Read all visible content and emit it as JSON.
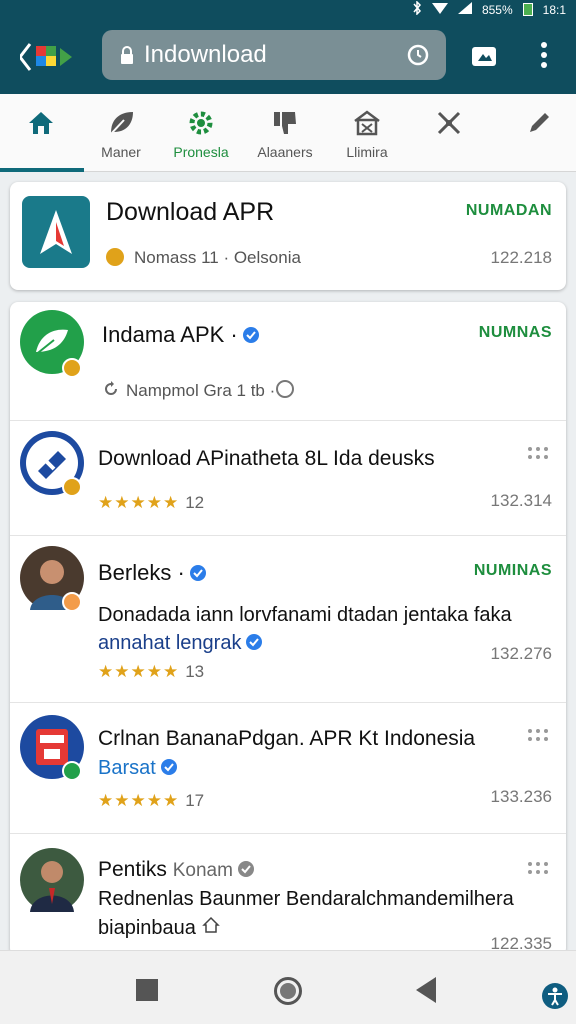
{
  "status_bar": {
    "battery_text": "855%",
    "time": "18:1"
  },
  "browser": {
    "url": "Indownload"
  },
  "categories": [
    {
      "label": "Maner",
      "icon": "home-icon",
      "active": true
    },
    {
      "label": "Manar",
      "icon": "leaf-icon"
    },
    {
      "label": "Pronesla",
      "icon": "gear-icon"
    },
    {
      "label": "Alaaners",
      "icon": "thumbs-down-icon"
    },
    {
      "label": "Llimira",
      "icon": "building-icon"
    },
    {
      "label": "",
      "icon": "tools-icon"
    },
    {
      "label": "",
      "icon": "pencil-icon"
    }
  ],
  "featured": {
    "title": "Download APR",
    "status": "NUMADAN",
    "meta": "Nomass 11 · Oelsonia",
    "number": "122.218"
  },
  "items": [
    {
      "title": "Indama APK ·",
      "status": "NUMNAS",
      "meta": "Nampmol Gra 1 tb ·"
    },
    {
      "title": "Download APinatheta 8L Ida deusks",
      "rating": "★★★★★",
      "count": "12",
      "number": "132.314"
    },
    {
      "title": "Berleks ·",
      "status": "NUMINAS",
      "desc": "Donadada iann lorvfanami dtadan jentaka faka",
      "tagline": "annahat lengrak",
      "rating": "★★★★★",
      "count": "13",
      "number": "132.276"
    },
    {
      "title": "Crlnan BananaPdgan. APR Kt Indonesia",
      "tagline": "Barsat",
      "rating": "★★★★★",
      "count": "17",
      "number": "133.236"
    },
    {
      "title": "Pentiks",
      "title_suffix": "Konam",
      "desc": "Rednenlas Baunmer Bendaralchmandemilhera",
      "tagline": "biapinbaua",
      "number": "122.335"
    }
  ],
  "colors": {
    "appbar": "#0f4d5e",
    "accent_green": "#1e8e3e",
    "star": "#e0a21a"
  }
}
